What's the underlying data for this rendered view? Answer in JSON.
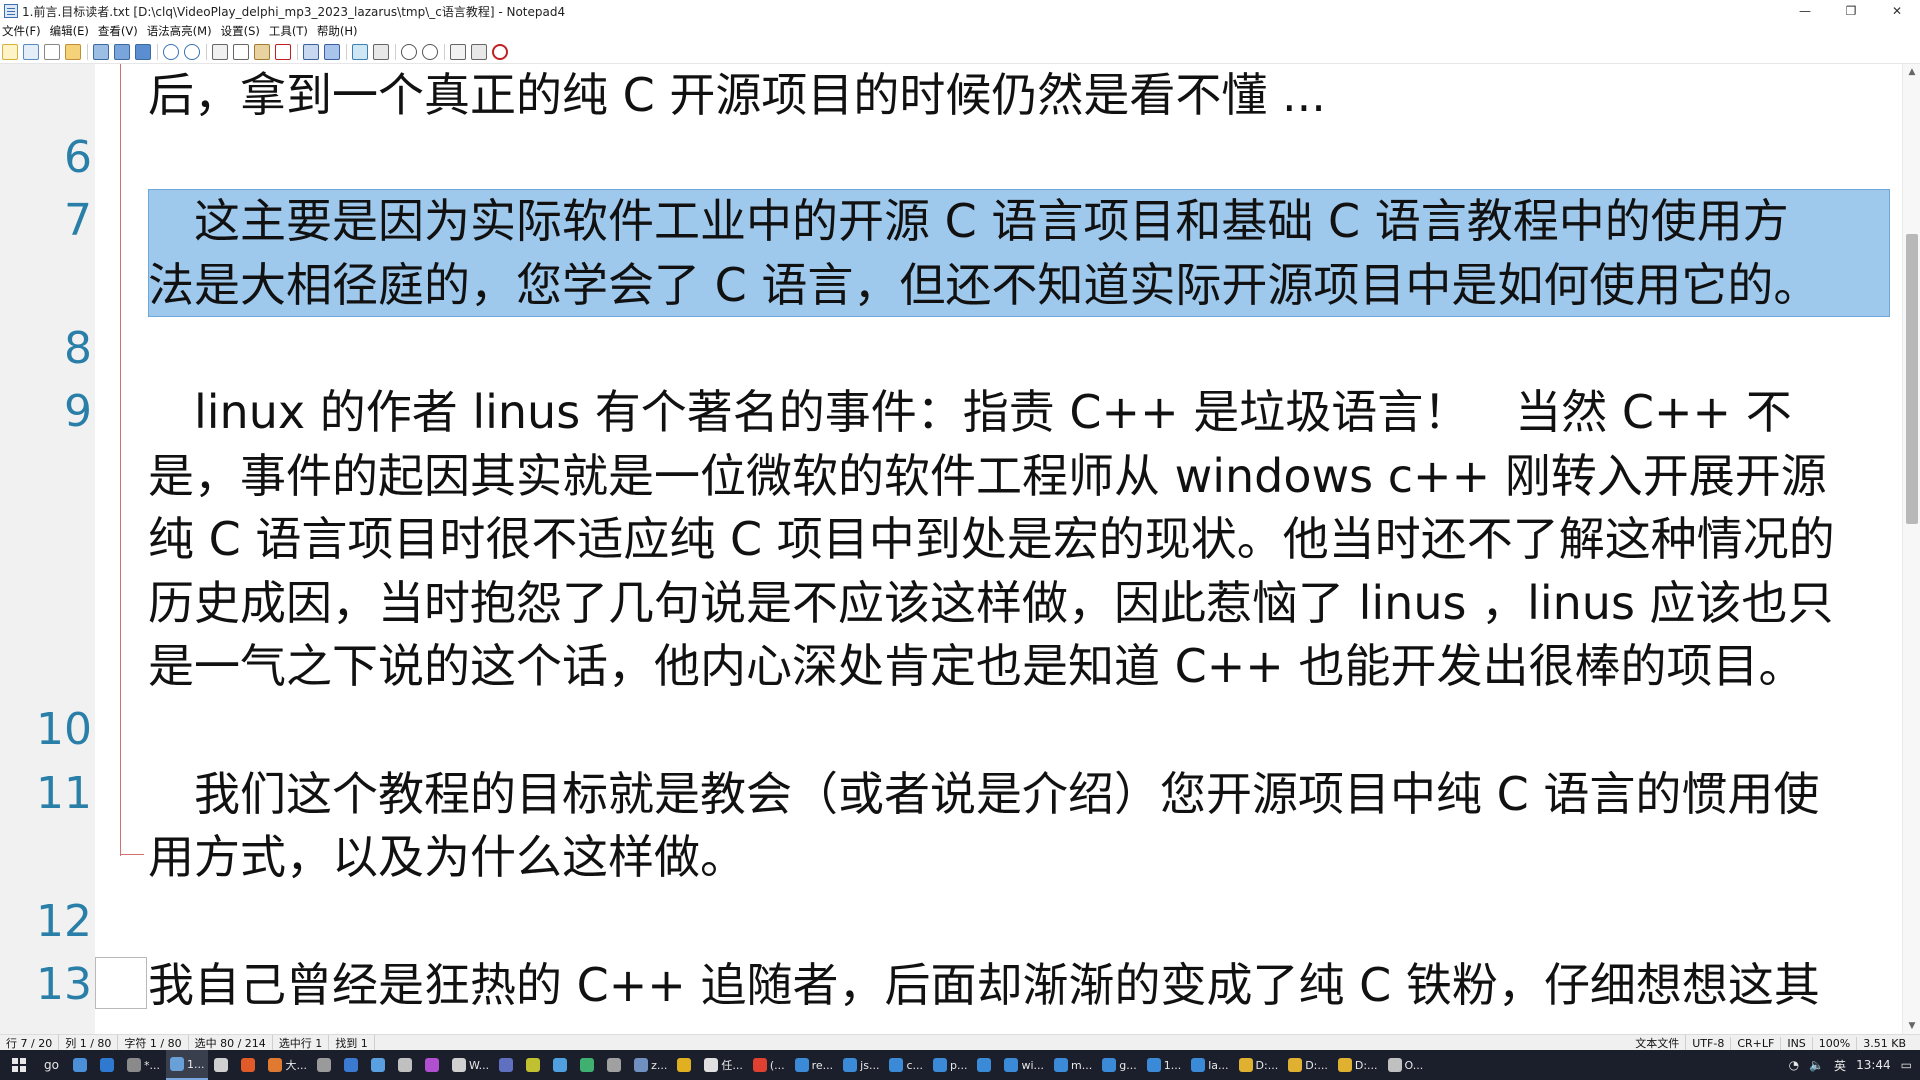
{
  "window": {
    "title": "1.前言.目标读者.txt [D:\\clq\\VideoPlay_delphi_mp3_2023_lazarus\\tmp\\_c语言教程] - Notepad4",
    "minimize": "—",
    "maximize": "❐",
    "close": "✕"
  },
  "menu": [
    {
      "label": "文件(F)"
    },
    {
      "label": "编辑(E)"
    },
    {
      "label": "查看(V)"
    },
    {
      "label": "语法高亮(M)"
    },
    {
      "label": "设置(S)"
    },
    {
      "label": "工具(T)"
    },
    {
      "label": "帮助(H)"
    }
  ],
  "toolbar": {
    "icons": [
      "new-icon",
      "open-icon",
      "save-icon",
      "save-as-icon",
      "undo-icon",
      "redo-icon",
      "cut-icon",
      "copy-icon",
      "paste-icon",
      "delete-icon",
      "find-icon",
      "replace-icon",
      "goto-icon",
      "zoom-in-icon",
      "zoom-out-icon",
      "scheme-icon",
      "settings-icon",
      "exit-icon"
    ]
  },
  "editor": {
    "lines": [
      {
        "num": "",
        "text": "后，拿到一个真正的纯 C 开源项目的时候仍然是看不懂 ..."
      },
      {
        "num": "6",
        "text": ""
      },
      {
        "num": "7",
        "text": "　这主要是因为实际软件工业中的开源 C 语言项目和基础 C 语言教程中的使用方"
      },
      {
        "num": "",
        "text": "法是大相径庭的，您学会了 C 语言，但还不知道实际开源项目中是如何使用它的。"
      },
      {
        "num": "8",
        "text": ""
      },
      {
        "num": "9",
        "text": "　linux 的作者 linus 有个著名的事件：指责 C++ 是垃圾语言！　当然 C++ 不"
      },
      {
        "num": "",
        "text": "是，事件的起因其实就是一位微软的软件工程师从 windows c++ 刚转入开展开源"
      },
      {
        "num": "",
        "text": "纯 C 语言项目时很不适应纯 C 项目中到处是宏的现状。他当时还不了解这种情况的"
      },
      {
        "num": "",
        "text": "历史成因，当时抱怨了几句说是不应该这样做，因此惹恼了 linus ，linus 应该也只"
      },
      {
        "num": "",
        "text": "是一气之下说的这个话，他内心深处肯定也是知道 C++ 也能开发出很棒的项目。"
      },
      {
        "num": "10",
        "text": ""
      },
      {
        "num": "11",
        "text": "　我们这个教程的目标就是教会（或者说是介绍）您开源项目中纯 C 语言的惯用使"
      },
      {
        "num": "",
        "text": "用方式，以及为什么这样做。"
      },
      {
        "num": "12",
        "text": ""
      },
      {
        "num": "13",
        "text": "我自己曾经是狂热的 C++ 追随者，后面却渐渐的变成了纯 C 铁粉，仔细想想这其"
      }
    ]
  },
  "statusbar": {
    "line": "行 7 / 20",
    "col": "列 1 / 80",
    "char": "字符 1 / 80",
    "sel": "选中 80 / 214",
    "sel_lines": "选中行 1",
    "found": "找到 1",
    "doc_type": "文本文件",
    "encoding": "UTF-8",
    "eol": "CR+LF",
    "ins": "INS",
    "zoom": "100%",
    "size": "3.51 KB"
  },
  "taskbar": {
    "search": "go",
    "items": [
      {
        "label": "",
        "color": "#4a8fd8"
      },
      {
        "label": "",
        "color": "#2f7ad0"
      },
      {
        "label": "*...",
        "color": "#8a8a8a"
      },
      {
        "label": "1...",
        "color": "#6aa0d8",
        "active": true
      },
      {
        "label": "",
        "color": "#d0d0d0"
      },
      {
        "label": "",
        "color": "#e05a2a"
      },
      {
        "label": "大...",
        "color": "#e07a30"
      },
      {
        "label": "",
        "color": "#9a9a9a"
      },
      {
        "label": "",
        "color": "#3a7ad0"
      },
      {
        "label": "",
        "color": "#5aa0e0"
      },
      {
        "label": "",
        "color": "#c0c0c0"
      },
      {
        "label": "",
        "color": "#b050d0"
      },
      {
        "label": "W...",
        "color": "#d0d0d0"
      },
      {
        "label": "",
        "color": "#6070c0"
      },
      {
        "label": "",
        "color": "#c0c030"
      },
      {
        "label": "",
        "color": "#50a0e0"
      },
      {
        "label": "",
        "color": "#40b070"
      },
      {
        "label": "",
        "color": "#a0a0a0"
      },
      {
        "label": "z...",
        "color": "#7090c0"
      },
      {
        "label": "",
        "color": "#e0b020"
      },
      {
        "label": "任...",
        "color": "#e0e0e0"
      },
      {
        "label": "(...",
        "color": "#e04030"
      },
      {
        "label": "re...",
        "color": "#3a8ad8"
      },
      {
        "label": "js...",
        "color": "#3a8ad8"
      },
      {
        "label": "c...",
        "color": "#3a8ad8"
      },
      {
        "label": "p...",
        "color": "#3a8ad8"
      },
      {
        "label": "",
        "color": "#3a8ad8"
      },
      {
        "label": "wi...",
        "color": "#3a8ad8"
      },
      {
        "label": "m...",
        "color": "#3a8ad8"
      },
      {
        "label": "g...",
        "color": "#3a8ad8"
      },
      {
        "label": "1...",
        "color": "#3a8ad8"
      },
      {
        "label": "la...",
        "color": "#3a8ad8"
      },
      {
        "label": "D:...",
        "color": "#e0b030"
      },
      {
        "label": "D:...",
        "color": "#e0b030"
      },
      {
        "label": "D:...",
        "color": "#e0b030"
      },
      {
        "label": "O...",
        "color": "#c0c0c0"
      }
    ],
    "ime": "英",
    "clock": "13:44"
  }
}
